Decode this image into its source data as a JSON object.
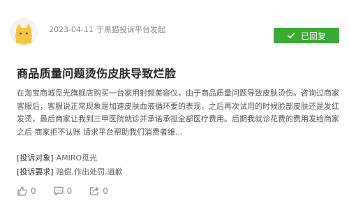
{
  "complaint": {
    "date": "2023-04-11",
    "source": "于黑猫投诉平台发起",
    "status": "已回复",
    "title": "商品质量问题烫伤皮肤导致烂脸",
    "content": "在淘宝商城觅光旗舰店购买一台家用射频美容仪，由于商品质量问题导致皮肤烫伤。咨询过商家客服后，客服说正常现象是加速皮肤血液循环要的表现，之后再次试用的时候脸部皮肤还是发红发烫，最后商家让我到三甲医院就诊并承诺承担全部医疗费用。后期我就诊花费的费用发给商家之后 商家拒不认账 请求平台帮助我们消费者维...",
    "object_label": "[投诉对象]",
    "object_value": "AMIRO觅光",
    "request_label": "[投诉要求]",
    "request_value": "赔偿,作出处罚,道歉"
  },
  "actions": {
    "like_count": "0",
    "comment_count": "0",
    "share_count": "0"
  },
  "icons": {
    "avatar": "cat-avatar-icon",
    "badge": "check-icon",
    "like": "thumbs-up-icon",
    "comment": "comment-icon",
    "share": "share-icon"
  },
  "colors": {
    "badge_bg": "#3aaa35",
    "avatar": "#f5c542"
  }
}
